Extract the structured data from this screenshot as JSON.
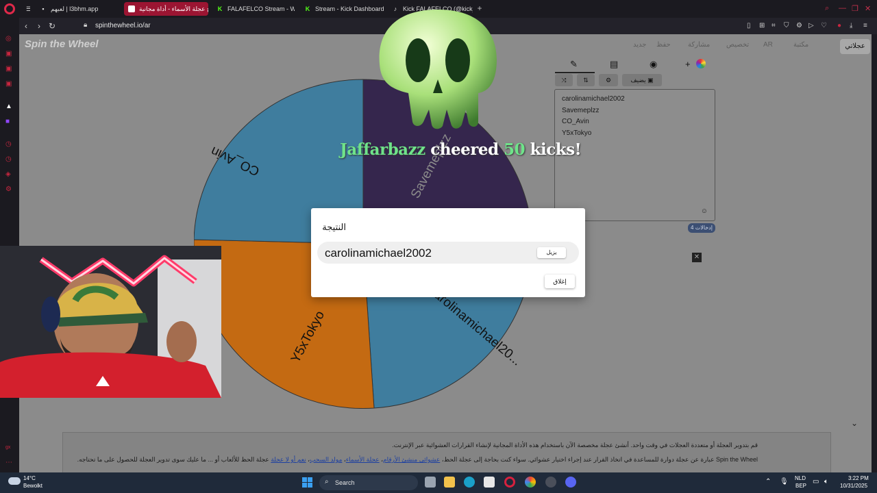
{
  "tabs": [
    {
      "label": "لعبهم | l3bhm.app",
      "icon": "page-icon"
    },
    {
      "label": "برنامج عجلة الأسماء - أداة مجانية",
      "icon": "spinthewheel-icon",
      "active": true
    },
    {
      "label": "FALAFELCO Stream - Wat",
      "icon": "kick-icon"
    },
    {
      "label": "Stream - Kick Dashboard",
      "icon": "kick-icon"
    },
    {
      "label": "Kick FALAFELCO (@kick_fa",
      "icon": "tiktok-icon"
    }
  ],
  "address": {
    "url": "spinthewheel.io/ar"
  },
  "page": {
    "logo": "Spin the Wheel",
    "my_wheels": "عجلاتي",
    "top_links": [
      "جديد",
      "حفظ",
      "مشاركة",
      "تخصيص",
      "AR",
      "مكتبة"
    ],
    "wheel_labels": [
      "CO_Avin",
      "Savemeplzz",
      "carolinamichael20...",
      "Y5xTokyo"
    ],
    "add_button": "يضيف",
    "entries": [
      "carolinamichael2002",
      "Savemeplzz",
      "CO_Avin",
      "Y5xTokyo"
    ],
    "entries_count": "إدخالات 4",
    "info_line1": "قم بتدوير العجلة أو متعددة العجلات في وقت واحد. أنشئ عجلة مخصصة الآن باستخدام هذه الأداة المجانية لإنشاء القرارات العشوائية عبر الإنترنت.",
    "info_line2_prefix": "Spin the Wheel عبارة عن عجلة دوارة للمساعدة في اتخاذ القرار عند إجراء اختيار عشوائي. سواء كنت بحاجة إلى عجلة الحظ،",
    "info_links": [
      "عشوائي منشئ الأرقام",
      "عجلة الأسماء",
      "مولد السحب",
      "نعم أو لا عجلة"
    ],
    "info_line2_suffix": "عجلة الحظ للألعاب أو ... ما عليك سوى تدوير العجلة للحصول على ما تحتاجه."
  },
  "alert": {
    "user": "Jaffarbazz",
    "middle": "cheered",
    "amount": "50",
    "unit": "kicks!"
  },
  "dialog": {
    "title": "النتيجة",
    "winner": "carolinamichael2002",
    "remove": "يزيل",
    "close": "إغلاق"
  },
  "taskbar": {
    "temp": "14°C",
    "condition": "Bewolkt",
    "search": "Search",
    "lang": "NLD",
    "lang2": "BEP",
    "time": "3:22 PM",
    "date": "10/31/2025"
  },
  "colors": {
    "accent": "#c8263f",
    "wheel_blue": "#3f7d9e",
    "wheel_purple": "#35264d",
    "wheel_orange": "#c46a12",
    "dialog_bg": "#ffffff"
  }
}
